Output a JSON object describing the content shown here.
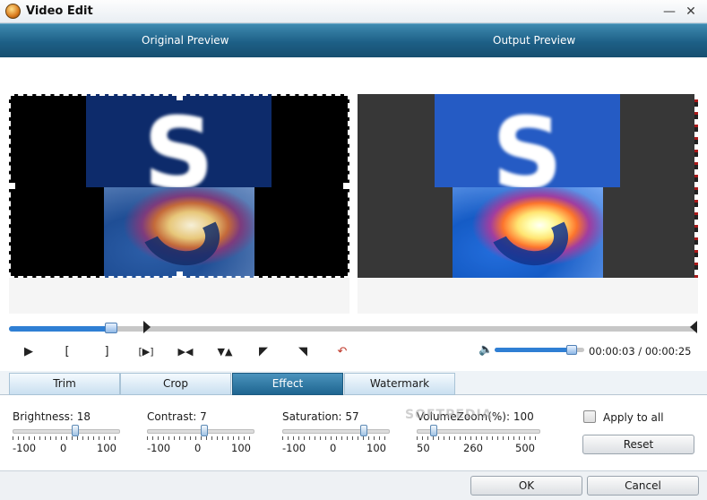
{
  "window": {
    "title": "Video Edit",
    "minimize_icon": "minimize-icon",
    "close_icon": "close-icon"
  },
  "preview": {
    "original_label": "Original Preview",
    "output_label": "Output Preview",
    "logo_letter": "S",
    "timeline_progress": 0.15
  },
  "controls": {
    "play_icon": "play-icon",
    "set_start_icon": "bracket-left-icon",
    "set_end_icon": "bracket-right-icon",
    "icons": [
      "play-icon",
      "mark-in-icon",
      "mark-out-icon",
      "next-frame-icon",
      "prev-frame-icon",
      "flip-vertical-icon",
      "rotate-left-icon",
      "rotate-right-icon",
      "undo-icon"
    ],
    "volume_icon": "speaker-icon",
    "volume_level": 0.86,
    "time_current": "00:00:03",
    "time_separator": " / ",
    "time_total": "00:00:25"
  },
  "tabs": [
    {
      "label": "Trim",
      "active": false
    },
    {
      "label": "Crop",
      "active": false
    },
    {
      "label": "Effect",
      "active": true
    },
    {
      "label": "Watermark",
      "active": false
    }
  ],
  "effect": {
    "brightness": {
      "label": "Brightness: 18",
      "min": "-100",
      "mid": "0",
      "max": "100",
      "value": 18,
      "range": [
        -100,
        100
      ]
    },
    "contrast": {
      "label": "Contrast: 7",
      "min": "-100",
      "mid": "0",
      "max": "100",
      "value": 7,
      "range": [
        -100,
        100
      ]
    },
    "saturation": {
      "label": "Saturation: 57",
      "min": "-100",
      "mid": "0",
      "max": "100",
      "value": 57,
      "range": [
        -100,
        100
      ]
    },
    "volume_zoom": {
      "label": "VolumeZoom(%): 100",
      "min": "50",
      "mid": "260",
      "max": "500",
      "value": 100,
      "range": [
        50,
        500
      ]
    },
    "apply_to_all_label": "Apply to all",
    "apply_to_all_checked": false,
    "reset_label": "Reset"
  },
  "footer": {
    "ok_label": "OK",
    "cancel_label": "Cancel"
  },
  "watermark_text": "SOFTPEDIA"
}
